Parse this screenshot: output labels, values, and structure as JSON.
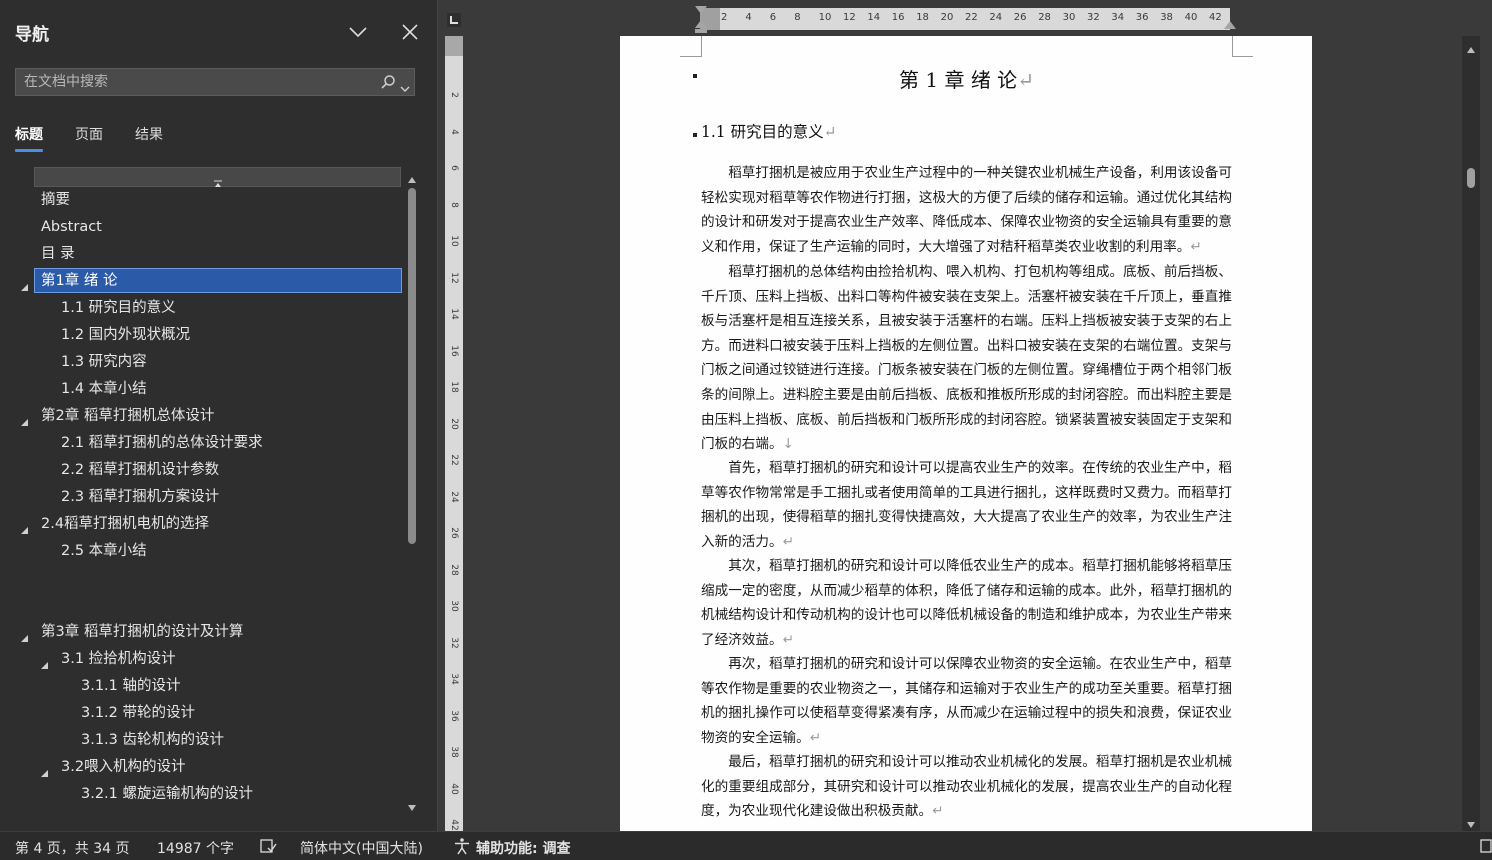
{
  "nav": {
    "title": "导航",
    "search_placeholder": "在文档中搜索",
    "tabs": [
      "标题",
      "页面",
      "结果"
    ],
    "active_tab": "标题",
    "items": [
      {
        "label": "摘要",
        "level": 0,
        "arrow": false,
        "selected": false
      },
      {
        "label": "Abstract",
        "level": 0,
        "arrow": false,
        "selected": false
      },
      {
        "label": "目  录",
        "level": 0,
        "arrow": false,
        "selected": false
      },
      {
        "label": "第1章 绪 论",
        "level": 0,
        "arrow": true,
        "selected": true
      },
      {
        "label": "1.1 研究目的意义",
        "level": 1,
        "arrow": false,
        "selected": false
      },
      {
        "label": "1.2 国内外现状概况",
        "level": 1,
        "arrow": false,
        "selected": false
      },
      {
        "label": "1.3 研究内容",
        "level": 1,
        "arrow": false,
        "selected": false
      },
      {
        "label": "1.4 本章小结",
        "level": 1,
        "arrow": false,
        "selected": false
      },
      {
        "label": "第2章 稻草打捆机总体设计",
        "level": 0,
        "arrow": true,
        "selected": false
      },
      {
        "label": "2.1 稻草打捆机的总体设计要求",
        "level": 1,
        "arrow": false,
        "selected": false
      },
      {
        "label": "2.2 稻草打捆机设计参数",
        "level": 1,
        "arrow": false,
        "selected": false
      },
      {
        "label": "2.3 稻草打捆机方案设计",
        "level": 1,
        "arrow": false,
        "selected": false
      },
      {
        "label": "2.4稻草打捆机电机的选择",
        "level": 0,
        "arrow": true,
        "selected": false
      },
      {
        "label": "2.5 本章小结",
        "level": 1,
        "arrow": false,
        "selected": false
      },
      {
        "label": "",
        "level": 0,
        "arrow": false,
        "selected": false,
        "spacer": true
      },
      {
        "label": "",
        "level": 0,
        "arrow": false,
        "selected": false,
        "spacer": true
      },
      {
        "label": "第3章 稻草打捆机的设计及计算",
        "level": 0,
        "arrow": true,
        "selected": false
      },
      {
        "label": "3.1 捡拾机构设计",
        "level": 1,
        "arrow": true,
        "selected": false
      },
      {
        "label": "3.1.1 轴的设计",
        "level": 2,
        "arrow": false,
        "selected": false
      },
      {
        "label": "3.1.2 带轮的设计",
        "level": 2,
        "arrow": false,
        "selected": false
      },
      {
        "label": "3.1.3 齿轮机构的设计",
        "level": 2,
        "arrow": false,
        "selected": false
      },
      {
        "label": "3.2喂入机构的设计",
        "level": 1,
        "arrow": true,
        "selected": false
      },
      {
        "label": "3.2.1 螺旋运输机构的设计",
        "level": 2,
        "arrow": false,
        "selected": false
      }
    ]
  },
  "ruler": {
    "h_numbers": [
      "2",
      "4",
      "6",
      "8",
      "10",
      "12",
      "14",
      "16",
      "18",
      "20",
      "22",
      "24",
      "26",
      "28",
      "30",
      "32",
      "34",
      "36",
      "38",
      "40",
      "42"
    ],
    "v_numbers": [
      "2",
      "4",
      "6",
      "8",
      "10",
      "12",
      "14",
      "16",
      "18",
      "20",
      "22",
      "24",
      "26",
      "28",
      "30",
      "32",
      "34",
      "36",
      "38",
      "40",
      "42"
    ]
  },
  "document": {
    "chapter_title": "第 1 章  绪  论",
    "section_title": "1.1  研究目的意义",
    "paragraphs": [
      "稻草打捆机是被应用于农业生产过程中的一种关键农业机械生产设备，利用该设备可轻松实现对稻草等农作物进行打捆，这极大的方便了后续的储存和运输。通过优化其结构的设计和研发对于提高农业生产效率、降低成本、保障农业物资的安全运输具有重要的意义和作用，保证了生产运输的同时，大大增强了对秸秆稻草类农业收割的利用率。",
      "稻草打捆机的总体结构由捡拾机构、喂入机构、打包机构等组成。底板、前后挡板、千斤顶、压料上挡板、出料口等构件被安装在支架上。活塞杆被安装在千斤顶上，垂直推板与活塞杆是相互连接关系，且被安装于活塞杆的右端。压料上挡板被安装于支架的右上方。而进料口被安装于压料上挡板的左侧位置。出料口被安装在支架的右端位置。支架与门板之间通过铰链进行连接。门板条被安装在门板的左侧位置。穿绳槽位于两个相邻门板条的间隙上。进料腔主要是由前后挡板、底板和推板所形成的封闭容腔。而出料腔主要是由压料上挡板、底板、前后挡板和门板所形成的封闭容腔。锁紧装置被安装固定于支架和门板的右端。",
      "首先，稻草打捆机的研究和设计可以提高农业生产的效率。在传统的农业生产中，稻草等农作物常常是手工捆扎或者使用简单的工具进行捆扎，这样既费时又费力。而稻草打捆机的出现，使得稻草的捆扎变得快捷高效，大大提高了农业生产的效率，为农业生产注入新的活力。",
      "其次，稻草打捆机的研究和设计可以降低农业生产的成本。稻草打捆机能够将稻草压缩成一定的密度，从而减少稻草的体积，降低了储存和运输的成本。此外，稻草打捆机的机械结构设计和传动机构的设计也可以降低机械设备的制造和维护成本，为农业生产带来了经济效益。",
      "再次，稻草打捆机的研究和设计可以保障农业物资的安全运输。在农业生产中，稻草等农作物是重要的农业物资之一，其储存和运输对于农业生产的成功至关重要。稻草打捆机的捆扎操作可以使稻草变得紧凑有序，从而减少在运输过程中的损失和浪费，保证农业物资的安全运输。",
      "最后，稻草打捆机的研究和设计可以推动农业机械化的发展。稻草打捆机是农业机械化的重要组成部分，其研究和设计可以推动农业机械化的发展，提高农业生产的自动化程度，为农业现代化建设做出积极贡献。"
    ],
    "para_marks": [
      "↵",
      "↓",
      "↵",
      "↵",
      "↵",
      "↵"
    ]
  },
  "status": {
    "page": "第 4 页，共 34 页",
    "words": "14987 个字",
    "language": "简体中文(中国大陆)",
    "accessibility": "辅助功能: 调查"
  }
}
